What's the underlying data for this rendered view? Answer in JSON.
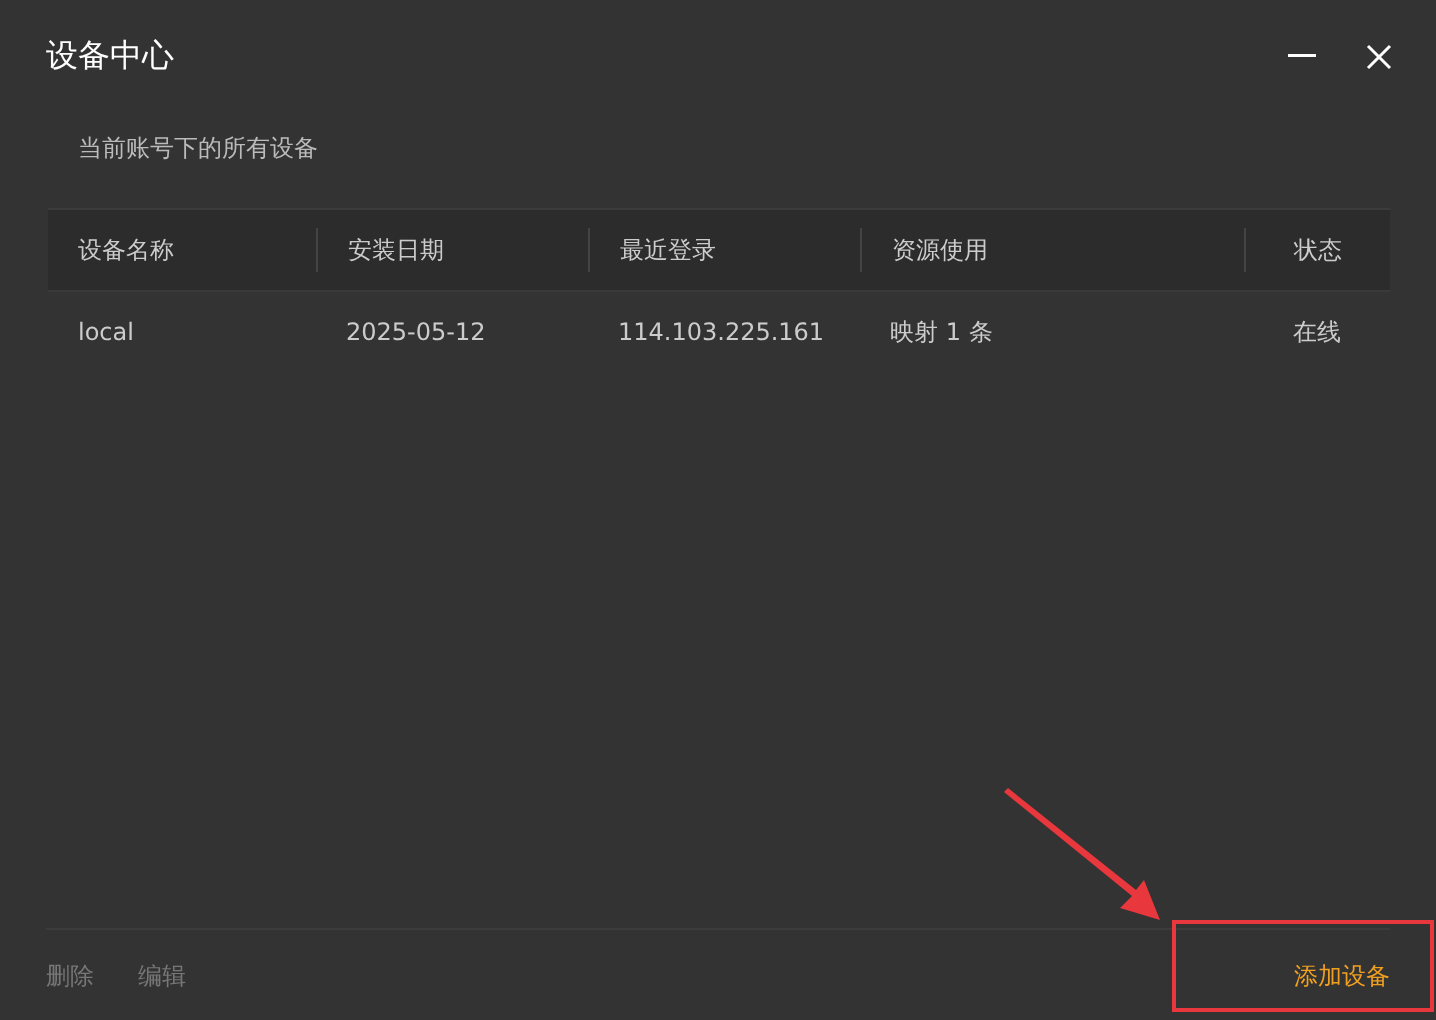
{
  "window": {
    "title": "设备中心"
  },
  "subtitle": "当前账号下的所有设备",
  "table": {
    "columns": [
      "设备名称",
      "安装日期",
      "最近登录",
      "资源使用",
      "状态"
    ],
    "rows": [
      [
        "local",
        "2025-05-12",
        "114.103.225.161",
        "映射 1 条",
        "在线"
      ]
    ]
  },
  "footer": {
    "buttons": [
      {
        "label": "删除",
        "disabled": true
      },
      {
        "label": "编辑",
        "disabled": true
      }
    ],
    "primary": {
      "label": "添加设备",
      "disabled": false
    }
  }
}
